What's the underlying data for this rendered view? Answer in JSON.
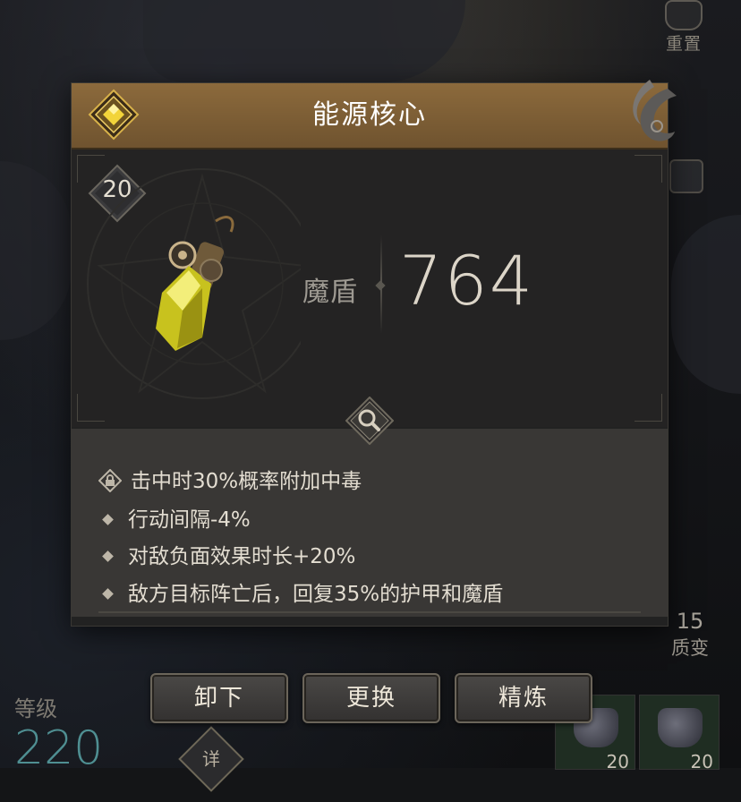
{
  "colors": {
    "header_gold": "#8c6a3c",
    "panel_bg": "#222222",
    "level_teal": "#4f8f92",
    "rarity_yellow": "#e6c229"
  },
  "top_right": {
    "reset_label": "重置",
    "reset_icon": "helmet-reset-icon"
  },
  "item": {
    "name": "能源核心",
    "level": "20",
    "stat_label": "魔盾",
    "stat_value": "764",
    "attributes": [
      {
        "text": "击中时30%概率附加中毒",
        "icon": "lock-icon"
      },
      {
        "text": "行动间隔-4%",
        "icon": "diamond-bullet"
      },
      {
        "text": "对敌负面效果时长+20%",
        "icon": "diamond-bullet"
      },
      {
        "text": "敌方目标阵亡后，回复35%的护甲和魔盾",
        "icon": "diamond-bullet"
      }
    ]
  },
  "actions": {
    "unequip": "卸下",
    "replace": "更换",
    "refine": "精炼"
  },
  "background": {
    "level_label": "等级",
    "level_value": "220",
    "detail_label": "详",
    "mutation_value": "15",
    "mutation_label": "质变",
    "slot_counts": [
      "20",
      "20"
    ]
  }
}
